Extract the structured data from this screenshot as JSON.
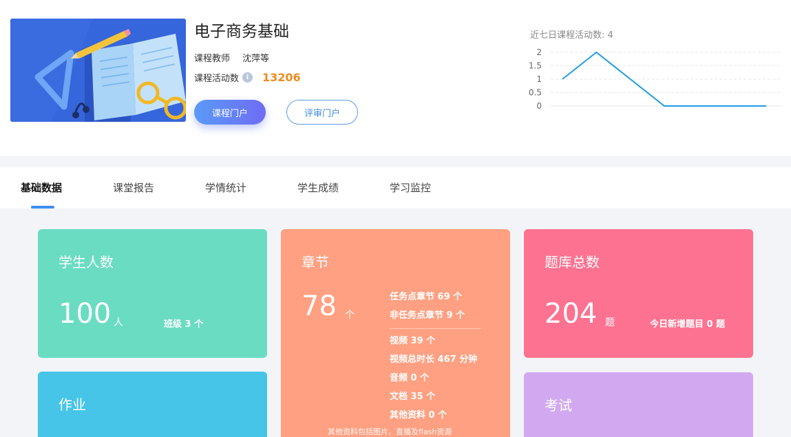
{
  "course": {
    "title": "电子商务基础",
    "teacher_label": "课程教师",
    "teacher_name": "沈萍等",
    "activity_label": "课程活动数",
    "activity_count": "13206",
    "portal_button": "课程门户",
    "review_button": "评审门户"
  },
  "chart_data": {
    "type": "line",
    "title": "近七日课程活动数: 4",
    "x": [
      1,
      2,
      3,
      4,
      5,
      6,
      7
    ],
    "values": [
      1,
      2,
      1,
      0,
      0,
      0,
      0
    ],
    "ylim": [
      0,
      2
    ],
    "yticks": [
      "2",
      "1.5",
      "1",
      "0.5",
      "0"
    ],
    "grid": true,
    "color": "#1e9be8"
  },
  "tabs": [
    {
      "label": "基础数据",
      "active": true
    },
    {
      "label": "课堂报告",
      "active": false
    },
    {
      "label": "学情统计",
      "active": false
    },
    {
      "label": "学生成绩",
      "active": false
    },
    {
      "label": "学习监控",
      "active": false
    }
  ],
  "cards": {
    "students": {
      "title": "学生人数",
      "value": "100",
      "unit": "人",
      "side": "班级 3 个",
      "color": "#6adcc2"
    },
    "chapters": {
      "title": "章节",
      "value": "78",
      "unit": "个",
      "lines1": [
        "任务点章节 69 个",
        "非任务点章节 9 个"
      ],
      "lines2": [
        "视频 39 个",
        "视频总时长 467 分钟",
        "音频 0 个",
        "文档 35 个",
        "其他资料 0 个"
      ],
      "note": "其他资料包括图片、直播及flash资源",
      "color": "#fea081"
    },
    "bank": {
      "title": "题库总数",
      "value": "204",
      "unit": "题",
      "side": "今日新增题目 0 题",
      "color": "#fd7290"
    },
    "homework": {
      "title": "作业",
      "color": "#46c5e8"
    },
    "exam": {
      "title": "考试",
      "color": "#d2a9f1"
    }
  }
}
